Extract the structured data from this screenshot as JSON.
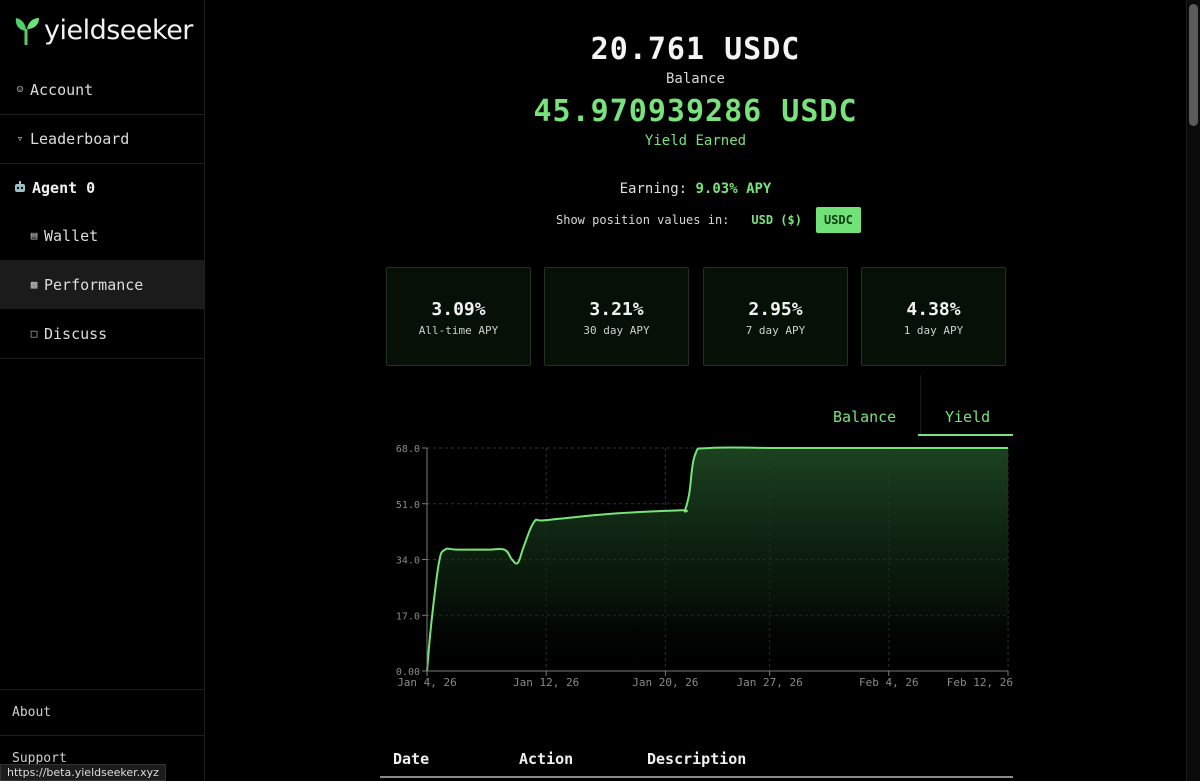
{
  "app": {
    "logo_text": "yieldseeker"
  },
  "sidebar": {
    "items": [
      {
        "label": "Account",
        "icon": "person-icon"
      },
      {
        "label": "Leaderboard",
        "icon": "trophy-icon"
      },
      {
        "label": "Agent 0",
        "icon": "robot-icon"
      },
      {
        "label": "Wallet",
        "icon": "wallet-icon"
      },
      {
        "label": "Performance",
        "icon": "bar-chart-icon",
        "active": true
      },
      {
        "label": "Discuss",
        "icon": "chat-icon"
      }
    ],
    "footer": {
      "about": "About",
      "support": "Support"
    },
    "status_url": "https://beta.yieldseeker.xyz"
  },
  "summary": {
    "balance_value": "20.761 USDC",
    "balance_label": "Balance",
    "yield_value": "45.970939286 USDC",
    "yield_label": "Yield Earned",
    "earning_label": "Earning:",
    "earning_value": "9.03% APY"
  },
  "position_toggle": {
    "label": "Show position values in:",
    "options": [
      "USD ($)",
      "USDC"
    ],
    "selected": "USDC"
  },
  "apy_cards": [
    {
      "value": "3.09%",
      "label": "All-time APY"
    },
    {
      "value": "3.21%",
      "label": "30 day APY"
    },
    {
      "value": "2.95%",
      "label": "7 day APY"
    },
    {
      "value": "4.38%",
      "label": "1 day APY"
    }
  ],
  "chart_tabs": {
    "items": [
      "Balance",
      "Yield"
    ],
    "selected": "Yield"
  },
  "chart_data": {
    "type": "area",
    "x_ticks": [
      "Jan 4, 26",
      "Jan 12, 26",
      "Jan 20, 26",
      "Jan 27, 26",
      "Feb 4, 26",
      "Feb 12, 26"
    ],
    "x_tick_days": [
      0,
      8,
      16,
      23,
      31,
      39
    ],
    "y_ticks": [
      "0.00",
      "17.0",
      "34.0",
      "51.0",
      "68.0"
    ],
    "ylim": [
      0,
      68
    ],
    "xlim_days": [
      0,
      39
    ],
    "series": [
      {
        "x_days": [
          0,
          0.3,
          0.8,
          1.2,
          2,
          4,
          5.2,
          5.7,
          6.1,
          6.5,
          7.2,
          8,
          12.5,
          17,
          17.3,
          17.6,
          18,
          19,
          24,
          30,
          39
        ],
        "values": [
          0,
          15,
          33,
          37,
          37,
          37,
          37,
          34,
          33,
          38,
          45.5,
          46,
          48,
          49,
          49,
          54,
          66,
          68,
          68,
          68,
          68
        ]
      }
    ],
    "colors": {
      "line": "#78e37b",
      "grid": "#333333",
      "axis": "#7a7a7a"
    }
  },
  "table": {
    "headers": [
      "Date",
      "Action",
      "Description"
    ]
  }
}
